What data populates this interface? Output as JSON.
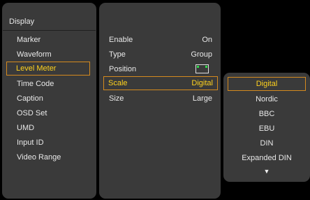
{
  "menu": {
    "title": "Display",
    "items": [
      {
        "label": "Marker"
      },
      {
        "label": "Waveform"
      },
      {
        "label": "Level Meter"
      },
      {
        "label": "Time Code"
      },
      {
        "label": "Caption"
      },
      {
        "label": "OSD Set"
      },
      {
        "label": "UMD"
      },
      {
        "label": "Input ID"
      },
      {
        "label": "Video Range"
      }
    ],
    "selected": "Level Meter"
  },
  "settings": {
    "rows": [
      {
        "label": "Enable",
        "value": "On"
      },
      {
        "label": "Type",
        "value": "Group"
      },
      {
        "label": "Position",
        "value_icon": "position-top-corners-icon"
      },
      {
        "label": "Scale",
        "value": "Digital"
      },
      {
        "label": "Size",
        "value": "Large"
      }
    ],
    "selected": "Scale"
  },
  "scale_options": {
    "items": [
      {
        "label": "Digital"
      },
      {
        "label": "Nordic"
      },
      {
        "label": "BBC"
      },
      {
        "label": "EBU"
      },
      {
        "label": "DIN"
      },
      {
        "label": "Expanded DIN"
      }
    ],
    "selected": "Digital",
    "more_indicator": "▼"
  },
  "colors": {
    "background": "#000000",
    "panel": "#3a3a3a",
    "text": "#e8e8e8",
    "selection_border": "#d48a1e",
    "selection_text": "#ffd21e",
    "position_marker": "#2fd84a"
  }
}
